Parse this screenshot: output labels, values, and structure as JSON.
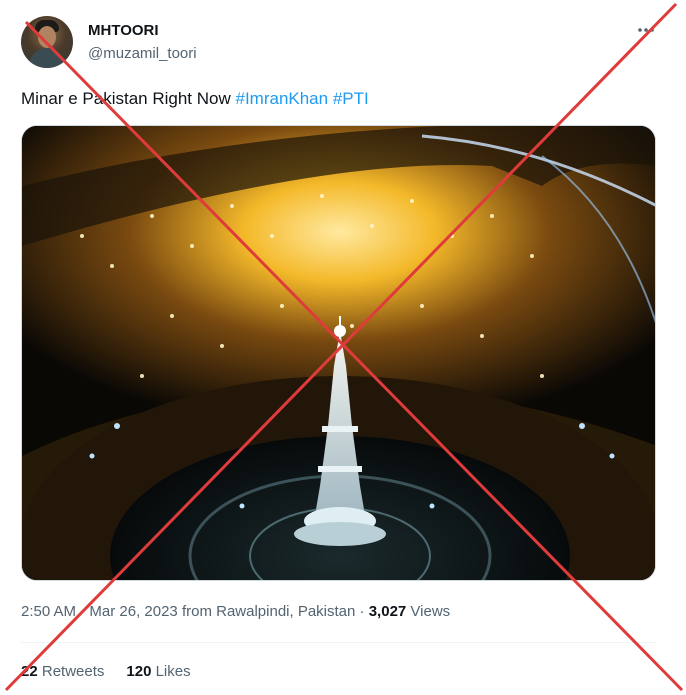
{
  "author": {
    "display_name": "MHTOORI",
    "handle": "@muzamil_toori"
  },
  "more_icon": "ellipsis-icon",
  "tweet": {
    "text": "Minar e Pakistan Right Now ",
    "hashtags": [
      "#ImranKhan",
      "#PTI"
    ]
  },
  "meta": {
    "time": "2:50 AM",
    "separator": " · ",
    "date": "Mar 26, 2023",
    "from_prefix": " from ",
    "location": "Rawalpindi, Pakistan",
    "views_count": "3,027",
    "views_label": " Views"
  },
  "stats": {
    "retweets_count": "22",
    "retweets_label": " Retweets",
    "likes_count": "120",
    "likes_label": " Likes"
  },
  "colors": {
    "hashtag": "#1d9bf0",
    "secondary_text": "#536471",
    "cross": "#e03b3b"
  }
}
